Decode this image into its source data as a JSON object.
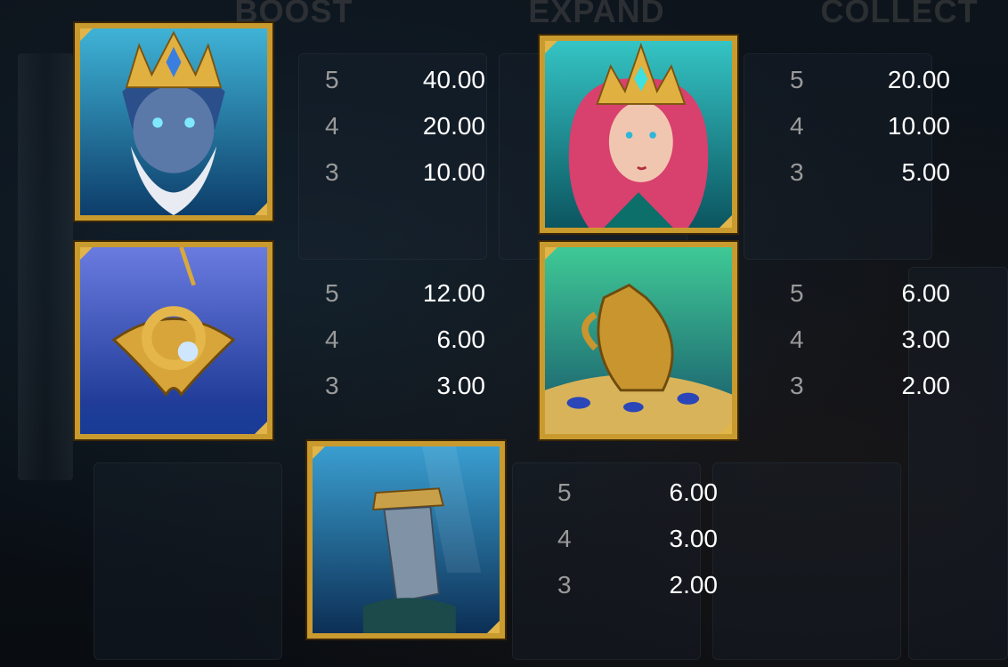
{
  "background": {
    "tabs": [
      "BOOST",
      "EXPAND",
      "COLLECT"
    ],
    "colors": {
      "frame_gold": "#c99a2e",
      "count_text": "#9a9a9a",
      "amount_text": "#ffffff"
    }
  },
  "symbols": [
    {
      "name": "sea-king",
      "icon": "sea-king-icon",
      "payouts": [
        {
          "count": "5",
          "amount": "40.00"
        },
        {
          "count": "4",
          "amount": "20.00"
        },
        {
          "count": "3",
          "amount": "10.00"
        }
      ]
    },
    {
      "name": "sea-queen",
      "icon": "sea-queen-icon",
      "payouts": [
        {
          "count": "5",
          "amount": "20.00"
        },
        {
          "count": "4",
          "amount": "10.00"
        },
        {
          "count": "3",
          "amount": "5.00"
        }
      ]
    },
    {
      "name": "golden-amulet",
      "icon": "amulet-icon",
      "payouts": [
        {
          "count": "5",
          "amount": "12.00"
        },
        {
          "count": "4",
          "amount": "6.00"
        },
        {
          "count": "3",
          "amount": "3.00"
        }
      ]
    },
    {
      "name": "golden-urn",
      "icon": "urn-icon",
      "payouts": [
        {
          "count": "5",
          "amount": "6.00"
        },
        {
          "count": "4",
          "amount": "3.00"
        },
        {
          "count": "3",
          "amount": "2.00"
        }
      ]
    },
    {
      "name": "sunken-column",
      "icon": "column-icon",
      "payouts": [
        {
          "count": "5",
          "amount": "6.00"
        },
        {
          "count": "4",
          "amount": "3.00"
        },
        {
          "count": "3",
          "amount": "2.00"
        }
      ]
    }
  ]
}
